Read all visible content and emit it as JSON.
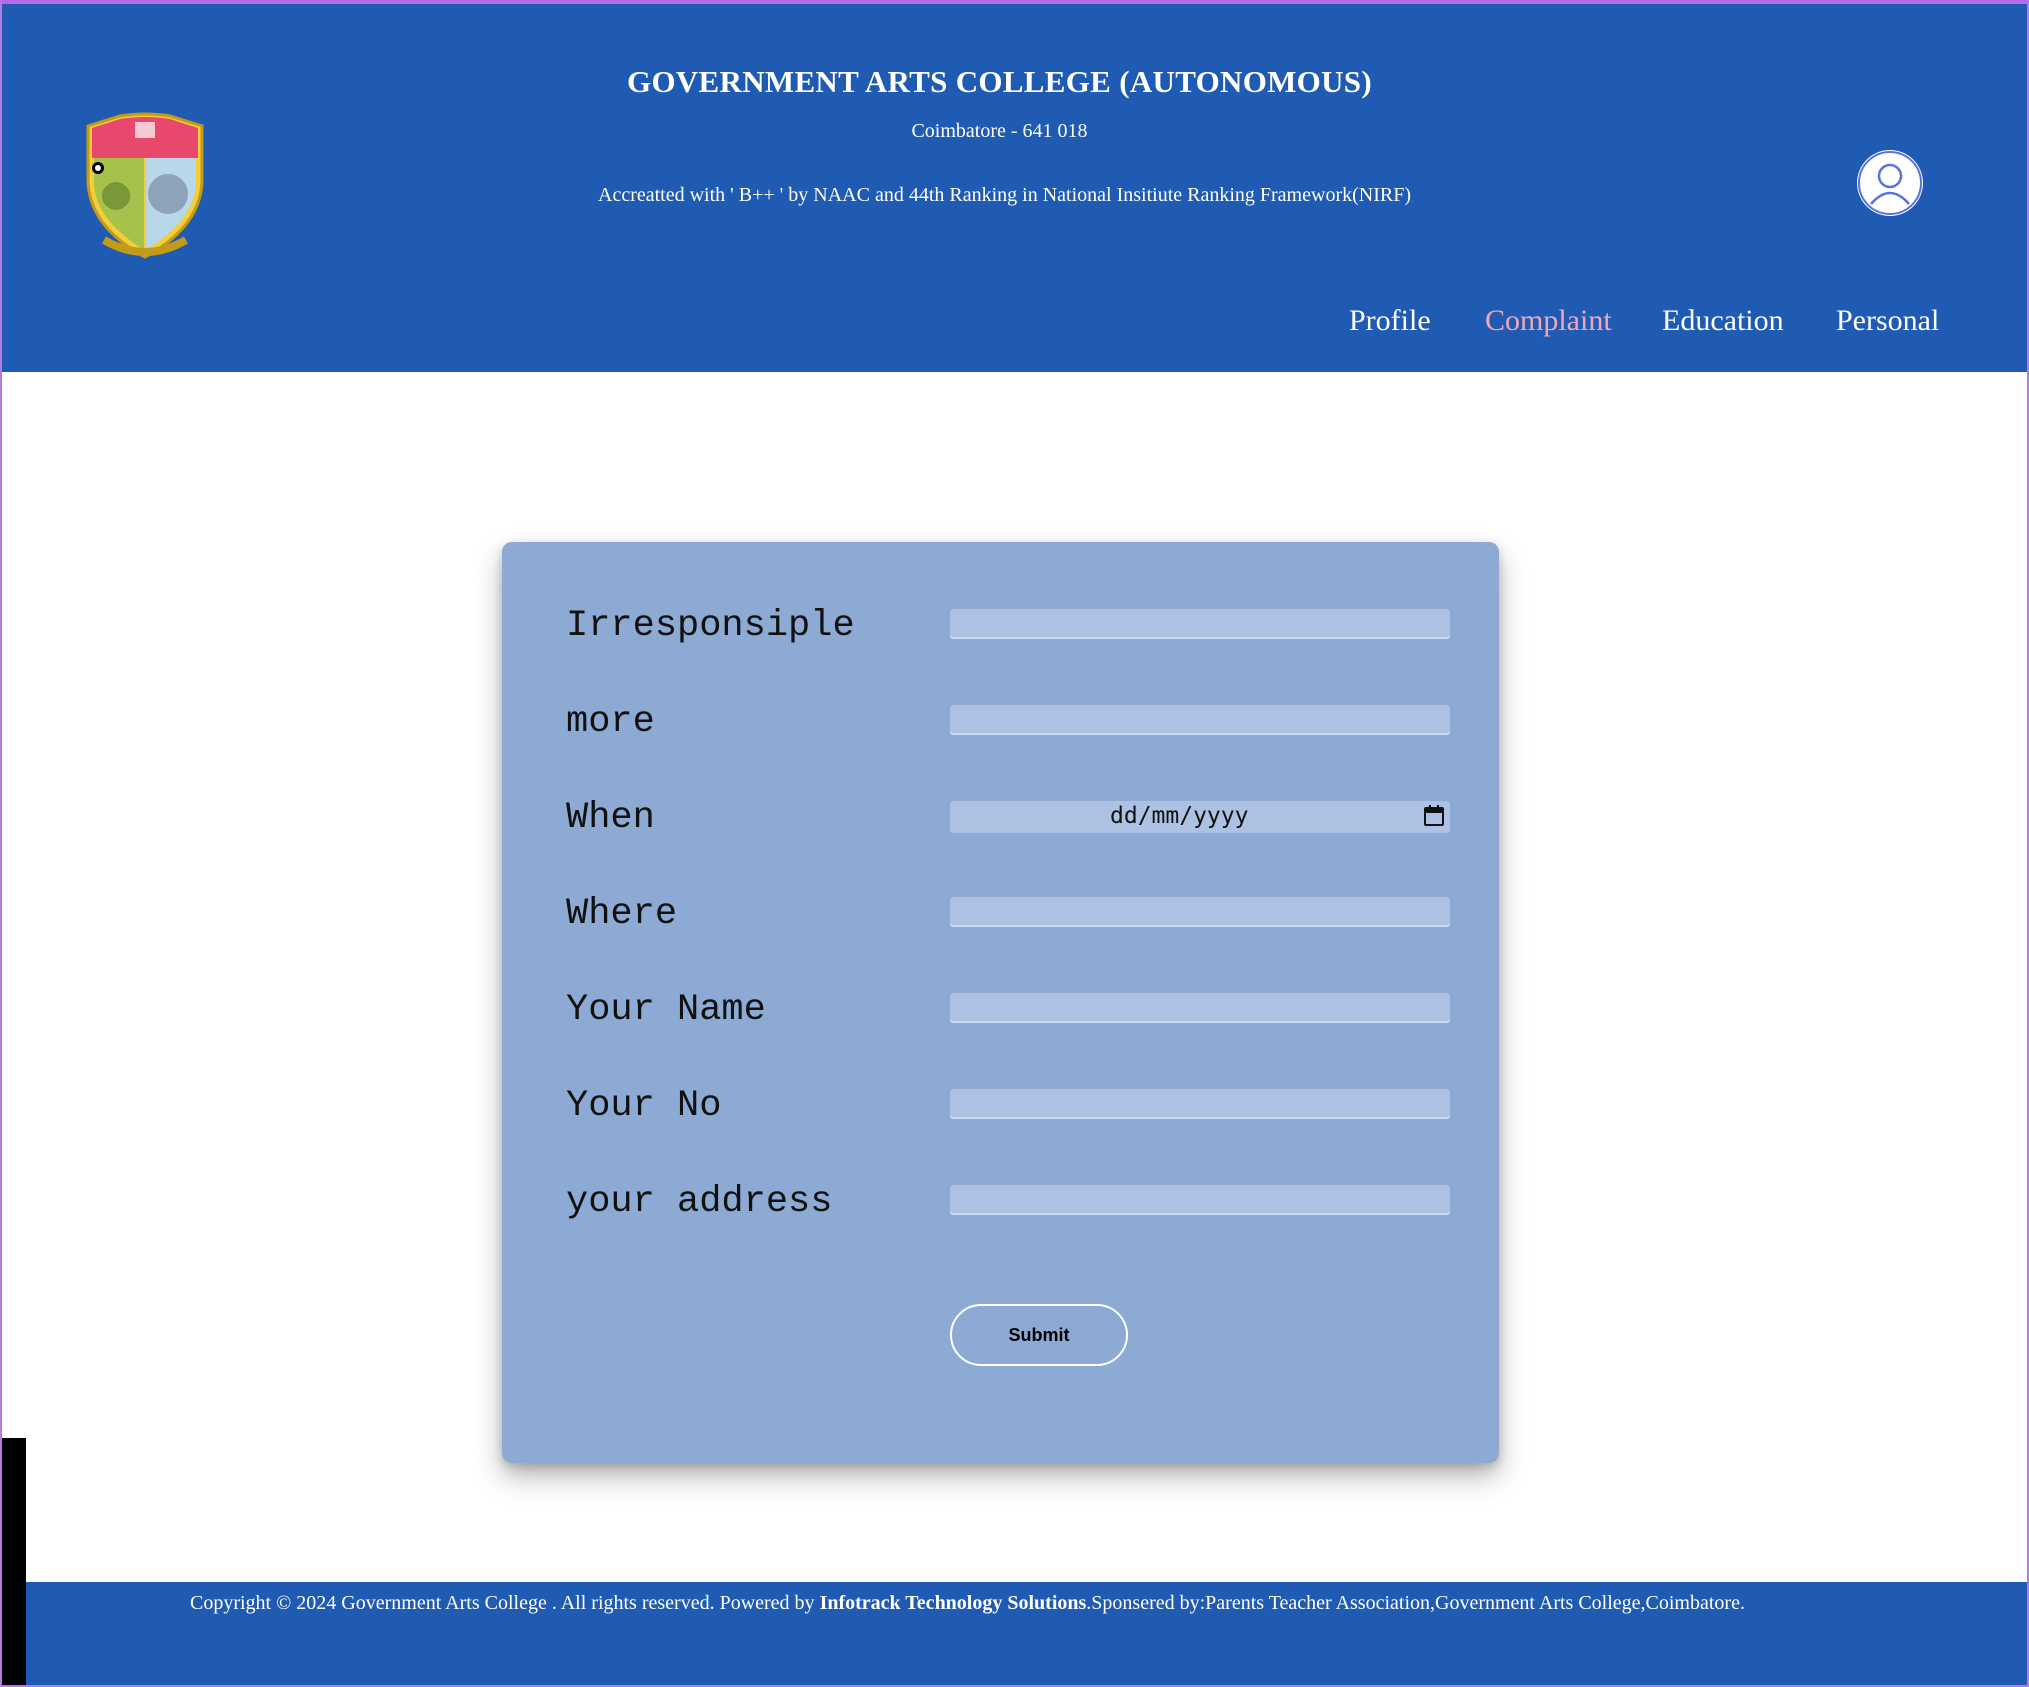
{
  "header": {
    "title": "GOVERNMENT ARTS COLLEGE (AUTONOMOUS)",
    "subtitle": "Coimbatore - 641 018",
    "accreditation": "Accreatted with ' B++ ' by NAAC and 44th Ranking in National Insitiute Ranking Framework(NIRF)",
    "logo_icon": "college-crest-icon",
    "avatar_icon": "user-avatar-icon"
  },
  "nav": {
    "items": [
      {
        "label": "Profile",
        "active": false
      },
      {
        "label": "Complaint",
        "active": true
      },
      {
        "label": "Education",
        "active": false
      },
      {
        "label": "Personal",
        "active": false
      }
    ],
    "active_color": "#f1a7b8"
  },
  "form": {
    "fields": [
      {
        "label": "Irresponsiple",
        "value": ""
      },
      {
        "label": "more",
        "value": ""
      },
      {
        "label": "When",
        "value": "",
        "placeholder": "dd/mm/yyyy"
      },
      {
        "label": "Where",
        "value": ""
      },
      {
        "label": "Your Name",
        "value": ""
      },
      {
        "label": "Your No",
        "value": ""
      },
      {
        "label": "your address",
        "value": ""
      }
    ],
    "submit_label": "Submit"
  },
  "footer": {
    "prefix": "Copyright © 2024 Government Arts College . All rights reserved. Powered by ",
    "company": "Infotrack Technology Solutions",
    "suffix": ".Sponsered by:Parents Teacher Association,Government Arts College,Coimbatore."
  },
  "colors": {
    "header_bg": "#1f5bb2",
    "card_bg": "#8caad3",
    "field_bg": "#adc2e2"
  }
}
